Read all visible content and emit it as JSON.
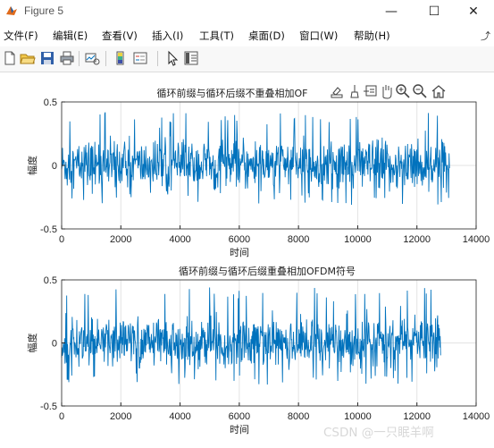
{
  "window": {
    "title": "Figure 5",
    "minimize_icon": "minimize-icon",
    "maximize_icon": "maximize-icon",
    "close_icon": "close-icon"
  },
  "menu": {
    "items": [
      "文件(F)",
      "编辑(E)",
      "查看(V)",
      "插入(I)",
      "工具(T)",
      "桌面(D)",
      "窗口(W)",
      "帮助(H)"
    ],
    "overflow_icon": "menu-overflow-arrow-icon"
  },
  "toolbar": {
    "buttons": [
      "new-figure-icon",
      "open-file-icon",
      "save-icon",
      "print-icon",
      "link-plot-icon",
      "insert-colorbar-icon",
      "insert-legend-icon",
      "edit-plot-arrow-icon",
      "property-inspector-icon"
    ]
  },
  "axes_toolbar": {
    "buttons": [
      "export-icon",
      "brush-icon",
      "datatip-icon",
      "pan-hand-icon",
      "zoom-in-icon",
      "zoom-out-icon",
      "home-icon"
    ]
  },
  "watermark": "CSDN @一只眠羊啊",
  "colors": {
    "line": "#0072bd",
    "grid": "#e3e3e3",
    "axis": "#262626"
  },
  "chart_data": [
    {
      "type": "line",
      "title": "循环前缀与循环后缀不重叠相加OF",
      "xlabel": "时间",
      "ylabel": "幅度",
      "xlim": [
        0,
        14000
      ],
      "ylim": [
        -0.5,
        0.5
      ],
      "xticks": [
        "0",
        "2000",
        "4000",
        "6000",
        "8000",
        "10000",
        "12000",
        "14000"
      ],
      "yticks": [
        "-0.5",
        "0",
        "0.5"
      ],
      "grid": true,
      "series": [
        {
          "x_range": [
            0,
            13100
          ],
          "y_range": [
            -0.31,
            0.42
          ],
          "typical_amplitude": 0.18
        }
      ]
    },
    {
      "type": "line",
      "title": "循环前缀与循环后缀重叠相加OFDM符号",
      "xlabel": "时间",
      "ylabel": "幅度",
      "xlim": [
        0,
        14000
      ],
      "ylim": [
        -0.5,
        0.5
      ],
      "xticks": [
        "0",
        "2000",
        "4000",
        "6000",
        "8000",
        "10000",
        "12000",
        "14000"
      ],
      "yticks": [
        "-0.5",
        "0",
        "0.5"
      ],
      "grid": true,
      "series": [
        {
          "x_range": [
            0,
            12800
          ],
          "y_range": [
            -0.33,
            0.44
          ],
          "typical_amplitude": 0.18
        }
      ]
    }
  ]
}
